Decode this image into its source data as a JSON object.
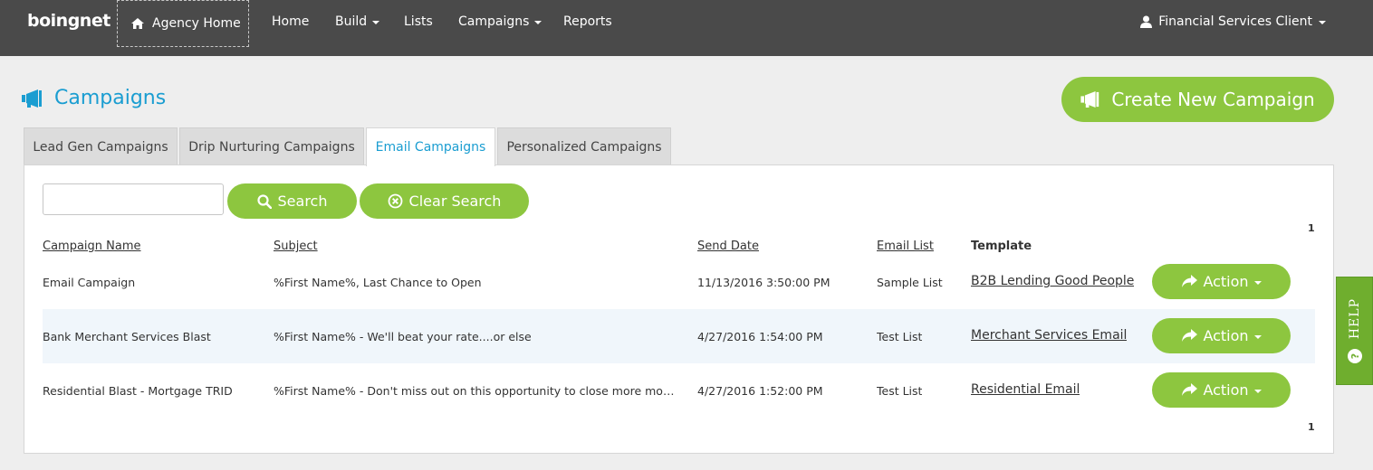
{
  "topbar": {
    "logo": "boingnet",
    "agency_home": "Agency Home",
    "nav": [
      {
        "label": "Home",
        "dropdown": false
      },
      {
        "label": "Build",
        "dropdown": true
      },
      {
        "label": "Lists",
        "dropdown": false
      },
      {
        "label": "Campaigns",
        "dropdown": true
      },
      {
        "label": "Reports",
        "dropdown": false
      }
    ],
    "user": "Financial Services Client"
  },
  "page": {
    "title": "Campaigns",
    "create_button": "Create New Campaign"
  },
  "tabs": [
    {
      "label": "Lead Gen Campaigns",
      "active": false
    },
    {
      "label": "Drip Nurturing Campaigns",
      "active": false
    },
    {
      "label": "Email Campaigns",
      "active": true
    },
    {
      "label": "Personalized Campaigns",
      "active": false
    }
  ],
  "search": {
    "value": "",
    "search_label": "Search",
    "clear_label": "Clear Search"
  },
  "pager": {
    "top": "1",
    "bottom": "1"
  },
  "table": {
    "headers": [
      "Campaign Name",
      "Subject",
      "Send Date",
      "Email List",
      "Template"
    ],
    "rows": [
      {
        "name": "Email Campaign",
        "subject": "%First Name%, Last Chance to Open",
        "send_date": "11/13/2016 3:50:00 PM",
        "list": "Sample List",
        "template": "B2B Lending Good People",
        "action": "Action"
      },
      {
        "name": "Bank Merchant Services Blast",
        "subject": "%First Name% - We'll beat your rate....or else",
        "send_date": "4/27/2016 1:54:00 PM",
        "list": "Test List",
        "template": "Merchant Services Email",
        "action": "Action"
      },
      {
        "name": "Residential Blast - Mortgage TRID",
        "subject": "%First Name% - Don't miss out on this opportunity to close more mortg...",
        "send_date": "4/27/2016 1:52:00 PM",
        "list": "Test List",
        "template": "Residential Email",
        "action": "Action"
      }
    ]
  },
  "help": {
    "label": "HELP"
  },
  "colors": {
    "accent": "#1a9dd1",
    "green": "#8dc63f",
    "topbar": "#4a4a4a"
  }
}
